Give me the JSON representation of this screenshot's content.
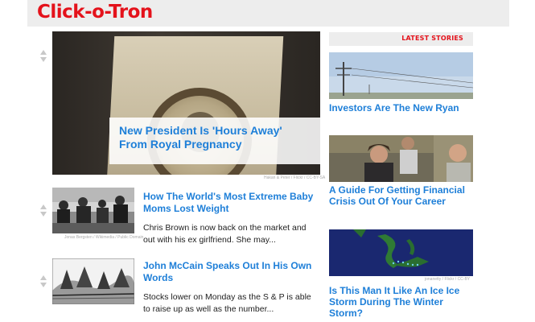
{
  "site": {
    "logo": "Click-o-Tron"
  },
  "hero": {
    "title": "New President Is 'Hours Away' From Royal Pregnancy",
    "credit": "Hakan & Peter / Flickr / CC-BY-SA"
  },
  "articles": [
    {
      "title": "How The World's Most Extreme Baby Moms Lost Weight",
      "summary": "Chris Brown is now back on the market and out with his ex girlfriend. She may...",
      "credit": "Jonas Bergsten / Wikimedia / Public Domain"
    },
    {
      "title": "John McCain Speaks Out In His Own Words",
      "summary": "Stocks lower on Monday as the S & P is able to raise up as well as the number..."
    }
  ],
  "sidebar": {
    "heading": "LATEST STORIES",
    "stories": [
      {
        "title": "Investors Are The New Ryan"
      },
      {
        "title": "A Guide For Getting Financial Crisis Out Of Your Career"
      },
      {
        "title": "Is This Man It Like An Ice Ice Storm During The Winter Storm?",
        "credit": "jonanetty / Flickr / CC-BY"
      }
    ]
  },
  "colors": {
    "brand_red": "#e4121b",
    "link_blue": "#1e7fd8",
    "bar_gray": "#ededed"
  },
  "icons": [
    "vote-up-icon",
    "vote-down-icon"
  ]
}
